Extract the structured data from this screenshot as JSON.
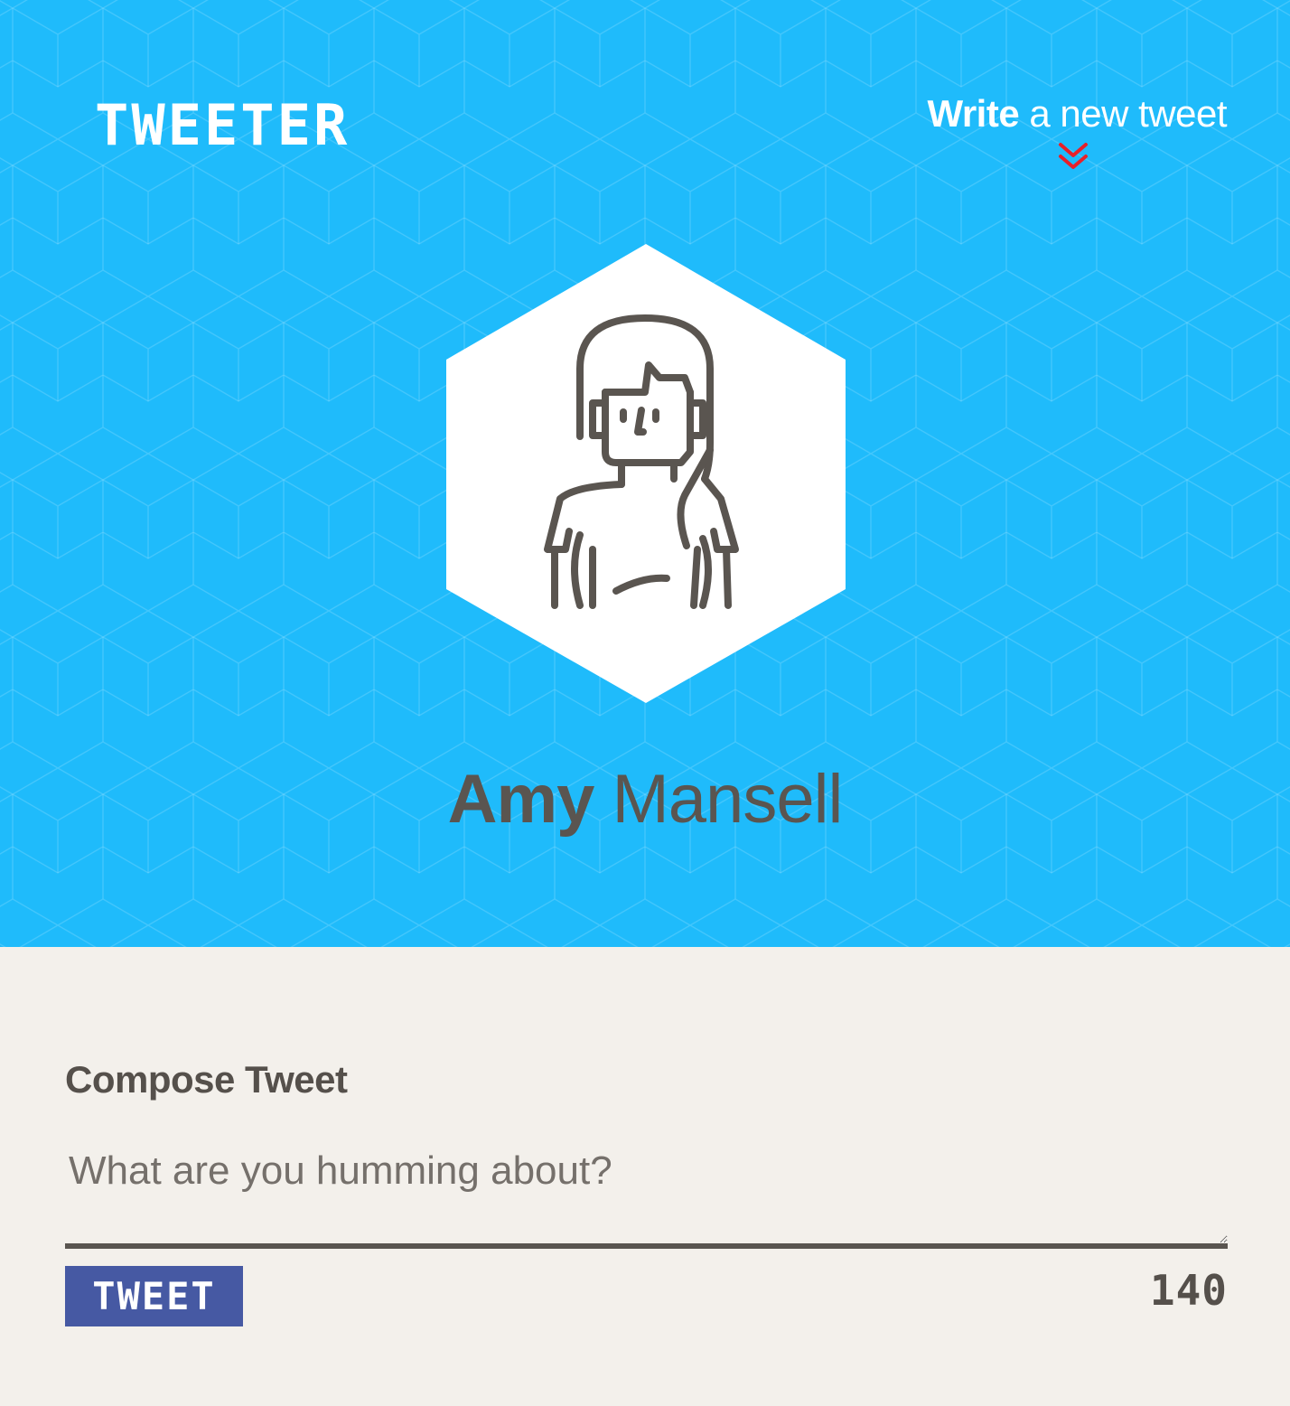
{
  "header": {
    "logo_text": "TWEETER",
    "write_link_bold": "Write",
    "write_link_rest": " a new tweet",
    "chevron_icon": "double-chevron-down-icon"
  },
  "profile": {
    "first_name": "Amy",
    "last_name": " Mansell",
    "avatar_icon": "woman-avatar-icon"
  },
  "compose": {
    "label": "Compose Tweet",
    "placeholder": "What are you humming about?",
    "value": "",
    "submit_label": "TWEET",
    "char_count": "140"
  },
  "colors": {
    "hero_background": "#1fbbfb",
    "page_background": "#f3f0eb",
    "button_background": "#4659a3",
    "chevron": "#e8202a",
    "text_dark": "#5a5550"
  }
}
